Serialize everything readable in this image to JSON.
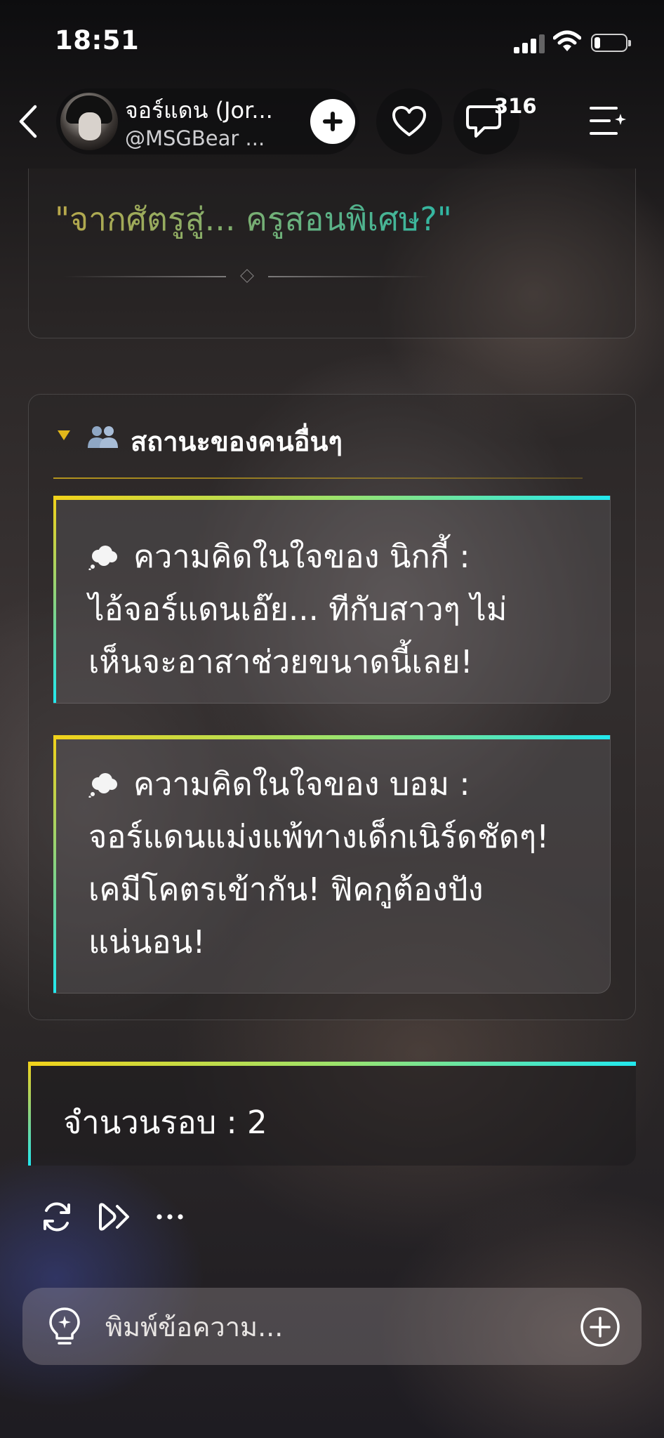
{
  "status_bar": {
    "time": "18:51",
    "icons": [
      "signal-icon",
      "wifi-icon",
      "battery-icon"
    ],
    "battery_level": 0.2
  },
  "header": {
    "back_icon": "chevron-left-icon",
    "character_name": "จอร์แดน (Jor...",
    "character_handle": "@MSGBear ...",
    "add_icon": "plus-icon",
    "like_icon": "heart-icon",
    "comment_icon": "comment-icon",
    "comment_count": "316",
    "menu_icon": "list-sparkle-icon"
  },
  "top_card": {
    "quote_title": "\"จากศัตรูสู่... ครูสอนพิเศษ?\""
  },
  "others_section": {
    "title": "สถานะของคนอื่นๆ",
    "caret_icon": "caret-down-icon",
    "people_icon": "people-icon",
    "thoughts": [
      {
        "icon": "thought-cloud-icon",
        "lines": [
          "ความคิดในใจของ นิกกี้ :",
          "ไอ้จอร์แดนเอ๊ย... ทีกับสาวๆ ไม่",
          "เห็นจะอาสาช่วยขนาดนี้เลย!"
        ]
      },
      {
        "icon": "thought-cloud-icon",
        "lines": [
          "ความคิดในใจของ บอม :",
          "จอร์แดนแม่งแพ้ทางเด็กเนิร์ดชัดๆ!",
          "เคมีโคตรเข้ากัน! ฟิคกูต้องปัง",
          "แน่นอน!"
        ]
      }
    ]
  },
  "round_card": {
    "text": "จำนวนรอบ : 2"
  },
  "actions": {
    "regenerate_icon": "refresh-icon",
    "continue_icon": "fast-forward-icon",
    "more_icon": "more-horizontal-icon"
  },
  "composer": {
    "placeholder": "พิมพ์ข้อความ...",
    "value": "",
    "hint_icon": "lightbulb-icon",
    "attach_icon": "plus-circle-icon"
  },
  "colors": {
    "accent_gold": "#e2b81a",
    "gradient_start": "#f2d21a",
    "gradient_mid": "#9ee36a",
    "gradient_end": "#22e8ee"
  }
}
